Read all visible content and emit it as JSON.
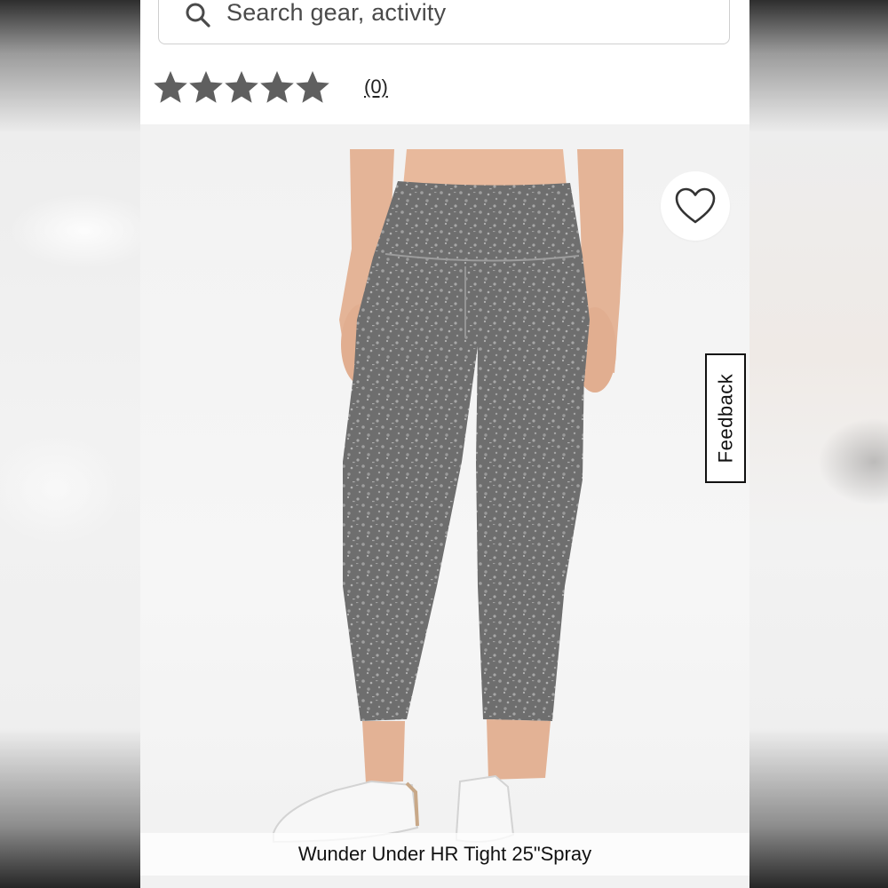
{
  "search": {
    "placeholder": "Search gear, activity",
    "icon": "search-icon"
  },
  "rating": {
    "stars_filled": 5,
    "stars_total": 5,
    "review_count": "(0)",
    "star_color": "#5f5f5f"
  },
  "product": {
    "caption": "Wunder Under HR Tight 25\"Spray",
    "image_description": "",
    "wishlist_icon": "heart-icon"
  },
  "feedback": {
    "label": "Feedback"
  },
  "colors": {
    "leggings": "#707070",
    "speckle": "#a9a9a9",
    "skin": "#e6b89c",
    "background": "#f3f3f3"
  }
}
